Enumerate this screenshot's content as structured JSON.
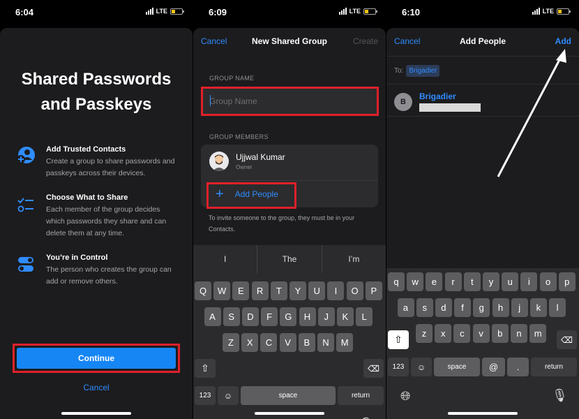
{
  "colors": {
    "accent": "#2f8cff",
    "highlight": "#e0202a",
    "sheet": "#1c1c1e"
  },
  "panel1": {
    "time": "6:04",
    "network": "LTE",
    "title_line1": "Shared Passwords",
    "title_line2": "and Passkeys",
    "features": [
      {
        "icon": "add-contact-icon",
        "title": "Add Trusted Contacts",
        "body": "Create a group to share passwords and passkeys across their devices."
      },
      {
        "icon": "checklist-icon",
        "title": "Choose What to Share",
        "body": "Each member of the group decides which passwords they share and can delete them at any time."
      },
      {
        "icon": "toggles-icon",
        "title": "You’re in Control",
        "body": "The person who creates the group can add or remove others."
      }
    ],
    "continue_label": "Continue",
    "cancel_label": "Cancel"
  },
  "panel2": {
    "time": "6:09",
    "network": "LTE",
    "nav": {
      "cancel": "Cancel",
      "title": "New Shared Group",
      "create": "Create"
    },
    "group_name_header": "GROUP NAME",
    "group_name_placeholder": "Group Name",
    "group_members_header": "GROUP MEMBERS",
    "member": {
      "name": "Ujjwal Kumar",
      "role": "Owner"
    },
    "add_people_label": "Add People",
    "invite_note": "To invite someone to the group, they must be in your Contacts.",
    "suggestions": [
      "I",
      "The",
      "I’m"
    ]
  },
  "panel3": {
    "time": "6:10",
    "network": "LTE",
    "nav": {
      "cancel": "Cancel",
      "title": "Add People",
      "add": "Add"
    },
    "to_label": "To:",
    "recipient_chip": "Brigadier",
    "contact": {
      "initial": "B",
      "name": "Brigadier"
    }
  },
  "keyboard": {
    "row1": [
      "Q",
      "W",
      "E",
      "R",
      "T",
      "Y",
      "U",
      "I",
      "O",
      "P"
    ],
    "row2": [
      "A",
      "S",
      "D",
      "F",
      "G",
      "H",
      "J",
      "K",
      "L"
    ],
    "row3": [
      "Z",
      "X",
      "C",
      "V",
      "B",
      "N",
      "M"
    ],
    "numbers_label": "123",
    "space_label": "space",
    "return_label": "return",
    "lower_row1": [
      "q",
      "w",
      "e",
      "r",
      "t",
      "y",
      "u",
      "i",
      "o",
      "p"
    ],
    "lower_row2": [
      "a",
      "s",
      "d",
      "f",
      "g",
      "h",
      "j",
      "k",
      "l"
    ],
    "lower_row3": [
      "z",
      "x",
      "c",
      "v",
      "b",
      "n",
      "m"
    ],
    "at_label": "@",
    "dot_label": "."
  }
}
